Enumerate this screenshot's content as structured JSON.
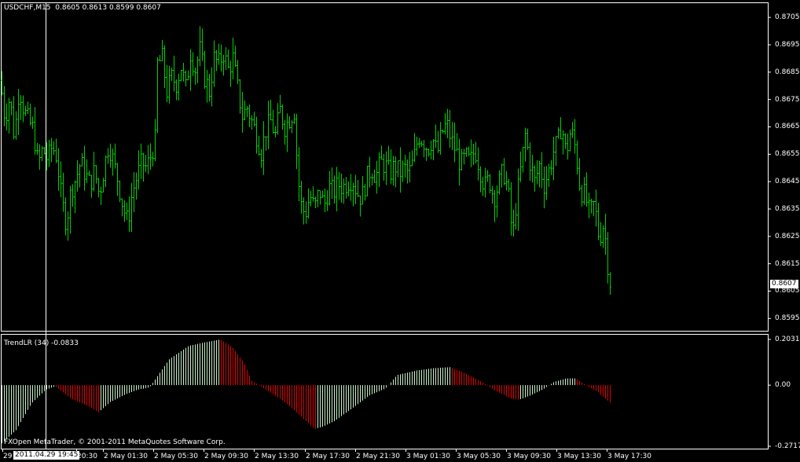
{
  "chart_data": [
    {
      "type": "bar",
      "chart_style": "ohlc-bars",
      "title": "USDCHF,M15  0.8605 0.8613 0.8599 0.8607",
      "symbol": "USDCHF",
      "timeframe": "M15",
      "ohlc_readout": [
        "0.8605",
        "0.8613",
        "0.8599",
        "0.8607"
      ],
      "current_price": "0.8607",
      "ylim": [
        0.85905,
        0.87105
      ],
      "y_ticks": [
        "0.8705",
        "0.8695",
        "0.8685",
        "0.8675",
        "0.8665",
        "0.8655",
        "0.8645",
        "0.8635",
        "0.8625",
        "0.8615",
        "0.8605",
        "0.8595"
      ],
      "bar_color": "#00d000",
      "background": "#000000",
      "price_path": [
        [
          0,
          0.8682
        ],
        [
          6,
          0.8668
        ],
        [
          12,
          0.8676
        ],
        [
          18,
          0.8661
        ],
        [
          24,
          0.868
        ],
        [
          30,
          0.8671
        ],
        [
          36,
          0.8667
        ],
        [
          42,
          0.8664
        ],
        [
          48,
          0.8651
        ],
        [
          54,
          0.8657
        ],
        [
          60,
          0.8653
        ],
        [
          66,
          0.8658
        ],
        [
          72,
          0.8654
        ],
        [
          78,
          0.8638
        ],
        [
          84,
          0.863
        ],
        [
          90,
          0.8642
        ],
        [
          96,
          0.8646
        ],
        [
          102,
          0.8652
        ],
        [
          108,
          0.8648
        ],
        [
          114,
          0.8644
        ],
        [
          120,
          0.8649
        ],
        [
          126,
          0.864
        ],
        [
          132,
          0.865
        ],
        [
          138,
          0.8659
        ],
        [
          144,
          0.8652
        ],
        [
          150,
          0.8645
        ],
        [
          156,
          0.8636
        ],
        [
          162,
          0.863
        ],
        [
          168,
          0.8641
        ],
        [
          174,
          0.8647
        ],
        [
          180,
          0.8652
        ],
        [
          186,
          0.865
        ],
        [
          192,
          0.8655
        ],
        [
          197,
          0.866
        ],
        [
          200,
          0.8688
        ],
        [
          206,
          0.869
        ],
        [
          212,
          0.8678
        ],
        [
          218,
          0.8683
        ],
        [
          224,
          0.8681
        ],
        [
          230,
          0.8687
        ],
        [
          236,
          0.8679
        ],
        [
          242,
          0.8692
        ],
        [
          248,
          0.8686
        ],
        [
          254,
          0.8693
        ],
        [
          260,
          0.8683
        ],
        [
          266,
          0.8678
        ],
        [
          272,
          0.869
        ],
        [
          278,
          0.8688
        ],
        [
          284,
          0.8692
        ],
        [
          290,
          0.8686
        ],
        [
          296,
          0.869
        ],
        [
          302,
          0.8679
        ],
        [
          308,
          0.8669
        ],
        [
          314,
          0.8672
        ],
        [
          320,
          0.8667
        ],
        [
          326,
          0.8662
        ],
        [
          332,
          0.8656
        ],
        [
          338,
          0.8664
        ],
        [
          344,
          0.8667
        ],
        [
          350,
          0.8662
        ],
        [
          356,
          0.8671
        ],
        [
          362,
          0.8665
        ],
        [
          368,
          0.8668
        ],
        [
          374,
          0.8671
        ],
        [
          378,
          0.865
        ],
        [
          382,
          0.8637
        ],
        [
          388,
          0.8633
        ],
        [
          394,
          0.864
        ],
        [
          400,
          0.8635
        ],
        [
          406,
          0.8642
        ],
        [
          412,
          0.8636
        ],
        [
          418,
          0.8643
        ],
        [
          424,
          0.8641
        ],
        [
          430,
          0.8644
        ],
        [
          436,
          0.8643
        ],
        [
          442,
          0.8645
        ],
        [
          448,
          0.8646
        ],
        [
          454,
          0.8641
        ],
        [
          460,
          0.8639
        ],
        [
          466,
          0.8646
        ],
        [
          472,
          0.865
        ],
        [
          478,
          0.8647
        ],
        [
          484,
          0.8652
        ],
        [
          490,
          0.8651
        ],
        [
          496,
          0.8648
        ],
        [
          502,
          0.8651
        ],
        [
          508,
          0.8648
        ],
        [
          514,
          0.865
        ],
        [
          520,
          0.8648
        ],
        [
          526,
          0.8653
        ],
        [
          532,
          0.8662
        ],
        [
          538,
          0.866
        ],
        [
          544,
          0.8657
        ],
        [
          550,
          0.8661
        ],
        [
          556,
          0.8655
        ],
        [
          562,
          0.8663
        ],
        [
          568,
          0.8666
        ],
        [
          574,
          0.866
        ],
        [
          580,
          0.8656
        ],
        [
          586,
          0.8651
        ],
        [
          592,
          0.8654
        ],
        [
          598,
          0.8652
        ],
        [
          604,
          0.8657
        ],
        [
          610,
          0.865
        ],
        [
          616,
          0.8643
        ],
        [
          622,
          0.8646
        ],
        [
          628,
          0.8639
        ],
        [
          634,
          0.8644
        ],
        [
          640,
          0.8649
        ],
        [
          646,
          0.8642
        ],
        [
          652,
          0.8624
        ],
        [
          656,
          0.8636
        ],
        [
          662,
          0.8649
        ],
        [
          668,
          0.8662
        ],
        [
          674,
          0.8652
        ],
        [
          680,
          0.8645
        ],
        [
          686,
          0.8651
        ],
        [
          692,
          0.8644
        ],
        [
          698,
          0.8649
        ],
        [
          704,
          0.8656
        ],
        [
          710,
          0.866
        ],
        [
          714,
          0.8666
        ],
        [
          720,
          0.8655
        ],
        [
          726,
          0.8664
        ],
        [
          732,
          0.8657
        ],
        [
          738,
          0.8642
        ],
        [
          744,
          0.864
        ],
        [
          750,
          0.8633
        ],
        [
          756,
          0.8637
        ],
        [
          762,
          0.8624
        ],
        [
          768,
          0.863
        ],
        [
          774,
          0.8612
        ],
        [
          778,
          0.8605
        ]
      ]
    },
    {
      "type": "bar",
      "chart_style": "histogram",
      "title": "TrendLR (34) -0.0833",
      "indicator": "TrendLR",
      "period": "34",
      "current_value": "-0.0833",
      "ylim": [
        -0.2717,
        0.2031
      ],
      "y_ticks": [
        "0.2031",
        "0.00",
        "-0.2717"
      ],
      "rising_color": "#c8f0c8",
      "falling_color": "#e00000",
      "value_path": [
        [
          0,
          -0.265
        ],
        [
          20,
          -0.2
        ],
        [
          40,
          -0.08
        ],
        [
          58,
          -0.02
        ],
        [
          70,
          -0.005
        ],
        [
          90,
          -0.06
        ],
        [
          110,
          -0.09
        ],
        [
          125,
          -0.12
        ],
        [
          140,
          -0.075
        ],
        [
          160,
          -0.04
        ],
        [
          175,
          -0.02
        ],
        [
          190,
          -0.01
        ],
        [
          200,
          0.04
        ],
        [
          215,
          0.115
        ],
        [
          240,
          0.175
        ],
        [
          260,
          0.19
        ],
        [
          280,
          0.2031
        ],
        [
          295,
          0.17
        ],
        [
          310,
          0.1
        ],
        [
          320,
          0.02
        ],
        [
          340,
          -0.025
        ],
        [
          360,
          -0.07
        ],
        [
          380,
          -0.13
        ],
        [
          400,
          -0.195
        ],
        [
          410,
          -0.185
        ],
        [
          425,
          -0.16
        ],
        [
          445,
          -0.11
        ],
        [
          470,
          -0.045
        ],
        [
          490,
          -0.015
        ],
        [
          505,
          0.045
        ],
        [
          530,
          0.065
        ],
        [
          550,
          0.075
        ],
        [
          572,
          0.08
        ],
        [
          590,
          0.055
        ],
        [
          610,
          0.02
        ],
        [
          630,
          -0.025
        ],
        [
          650,
          -0.06
        ],
        [
          660,
          -0.065
        ],
        [
          675,
          -0.045
        ],
        [
          690,
          -0.02
        ],
        [
          705,
          0.015
        ],
        [
          720,
          0.03
        ],
        [
          732,
          0.03
        ],
        [
          745,
          0.0
        ],
        [
          760,
          -0.03
        ],
        [
          770,
          -0.06
        ],
        [
          778,
          -0.0833
        ]
      ]
    }
  ],
  "x_axis": {
    "labels": [
      "29",
      "20:30",
      "2 May 01:30",
      "2 May 05:30",
      "2 May 09:30",
      "2 May 13:30",
      "2 May 17:30",
      "2 May 21:30",
      "3 May 01:30",
      "3 May 05:30",
      "3 May 09:30",
      "3 May 13:30",
      "3 May 17:30"
    ],
    "cursor_time": "2011.04.29 19:45"
  },
  "footer": {
    "copyright": "FXOpen MetaTrader, © 2001-2011 MetaQuotes Software Corp."
  },
  "colors": {
    "frame": "#ffffff",
    "bull_bar": "#00d000"
  }
}
